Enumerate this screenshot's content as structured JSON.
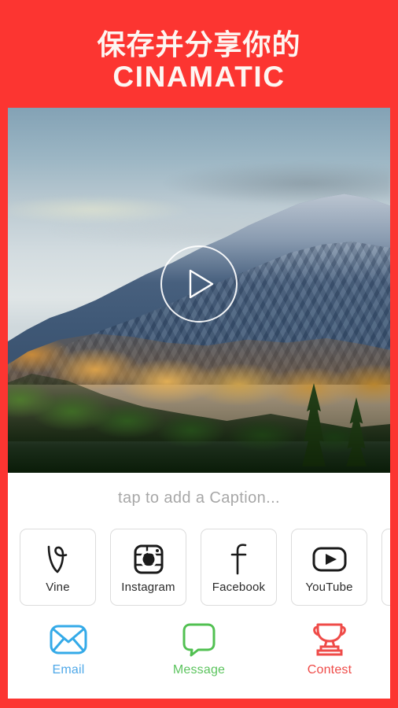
{
  "header": {
    "line1": "保存并分享你的",
    "line2": "CINAMATIC",
    "background_color": "#fc3531",
    "text_color": "#fdf6f2"
  },
  "video": {
    "name": "video-preview",
    "play_icon": "play-icon",
    "scene_description": "snow-capped mountain with autumn forest"
  },
  "caption": {
    "placeholder": "tap to add a Caption...",
    "value": ""
  },
  "share": {
    "items": [
      {
        "label": "Vine",
        "icon": "vine-icon"
      },
      {
        "label": "Instagram",
        "icon": "instagram-icon"
      },
      {
        "label": "Facebook",
        "icon": "facebook-icon"
      },
      {
        "label": "YouTube",
        "icon": "youtube-icon"
      },
      {
        "label": "",
        "icon": "more-icon"
      }
    ]
  },
  "actions": {
    "items": [
      {
        "label": "Email",
        "icon": "envelope-icon",
        "color": "#4fa8e8"
      },
      {
        "label": "Message",
        "icon": "speech-bubble-icon",
        "color": "#5cc45e"
      },
      {
        "label": "Contest",
        "icon": "trophy-icon",
        "color": "#ef4b48"
      }
    ]
  }
}
